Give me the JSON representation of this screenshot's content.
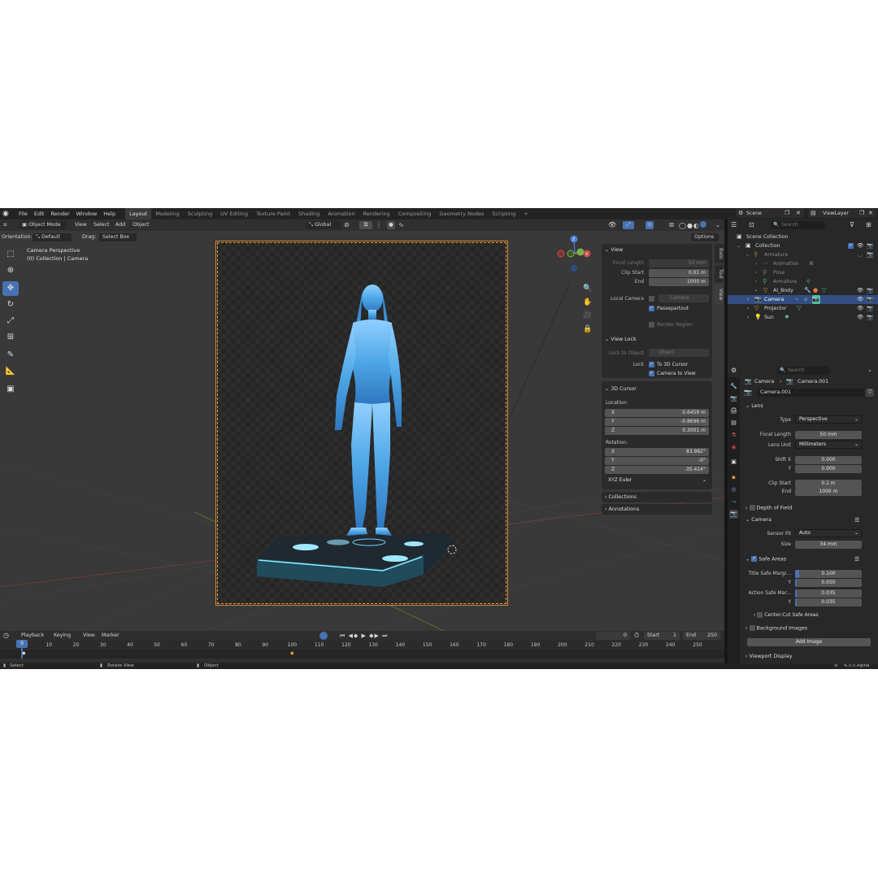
{
  "menu": [
    "File",
    "Edit",
    "Render",
    "Window",
    "Help"
  ],
  "workspaces": [
    "Layout",
    "Modeling",
    "Sculpting",
    "UV Editing",
    "Texture Paint",
    "Shading",
    "Animation",
    "Rendering",
    "Compositing",
    "Geometry Nodes",
    "Scripting"
  ],
  "active_workspace": "Layout",
  "add_tab": "+",
  "scene": "Scene",
  "view_layer": "ViewLayer",
  "viewport": {
    "mode": "Object Mode",
    "menus": [
      "View",
      "Select",
      "Add",
      "Object"
    ],
    "orientation_label": "Orientation:",
    "orientation": "Default",
    "drag_label": "Drag:",
    "drag": "Select Box",
    "transform": "Global",
    "options": "Options",
    "info_line1": "Camera Perspective",
    "info_line2": "(0) Collection | Camera"
  },
  "npanel": {
    "tabs": [
      "Item",
      "Tool",
      "View"
    ],
    "view": {
      "title": "View",
      "focal_length_label": "Focal Length",
      "focal_length": "50 mm",
      "clip_start_label": "Clip Start",
      "clip_start": "0.01 m",
      "end_label": "End",
      "end": "1000 m",
      "local_camera_label": "Local Camera",
      "local_camera": "Camera",
      "passepartout": "Passepartout",
      "render_region": "Render Region"
    },
    "view_lock": {
      "title": "View Lock",
      "lock_to_object_label": "Lock to Object",
      "lock_to_object": "Object",
      "lock_label": "Lock",
      "to_cursor": "To 3D Cursor",
      "camera_to_view": "Camera to View"
    },
    "cursor": {
      "title": "3D Cursor",
      "location_label": "Location:",
      "loc_x": "0.6459 m",
      "loc_y": "-0.8696 m",
      "loc_z": "0.3001 m",
      "rotation_label": "Rotation:",
      "rot_x": "83.982°",
      "rot_y": "-0°",
      "rot_z": "-35.414°",
      "mode": "XYZ Euler",
      "x": "X",
      "y": "Y",
      "z": "Z"
    },
    "collections": "Collections",
    "annotations": "Annotations"
  },
  "timeline": {
    "menus": [
      "Playback",
      "Keying",
      "View",
      "Marker"
    ],
    "current_frame": "0",
    "start_label": "Start",
    "start": "1",
    "end_label": "End",
    "end": "250",
    "ticks": [
      "0",
      "10",
      "20",
      "30",
      "40",
      "50",
      "60",
      "70",
      "80",
      "90",
      "100",
      "110",
      "120",
      "130",
      "140",
      "150",
      "160",
      "170",
      "180",
      "190",
      "200",
      "210",
      "220",
      "230",
      "240",
      "250"
    ]
  },
  "status": {
    "select": "Select",
    "rotate": "Rotate View",
    "object": "Object",
    "version": "4.3.0 Alpha"
  },
  "outliner": {
    "search": "Search",
    "rows": [
      {
        "name": "Scene Collection",
        "indent": 0
      },
      {
        "name": "Collection",
        "indent": 1
      },
      {
        "name": "Armature",
        "indent": 2
      },
      {
        "name": "Animation",
        "indent": 3
      },
      {
        "name": "Pose",
        "indent": 3
      },
      {
        "name": "Armature",
        "indent": 3
      },
      {
        "name": "AI_Body",
        "indent": 3
      },
      {
        "name": "Camera",
        "indent": 2
      },
      {
        "name": "Projector",
        "indent": 2
      },
      {
        "name": "Sun",
        "indent": 2
      }
    ]
  },
  "properties": {
    "search": "Search",
    "breadcrumb_obj": "Camera",
    "breadcrumb_data": "Camera.001",
    "datablock": "Camera.001",
    "lens": {
      "title": "Lens",
      "type_label": "Type",
      "type": "Perspective",
      "focal_label": "Focal Length",
      "focal": "50 mm",
      "unit_label": "Lens Unit",
      "unit": "Millimeters",
      "shiftx_label": "Shift X",
      "shiftx": "0.000",
      "y_label": "Y",
      "shifty": "0.000",
      "clip_start_label": "Clip Start",
      "clip_start": "0.1 m",
      "end_label": "End",
      "end": "1000 m"
    },
    "dof": "Depth of Field",
    "camera": {
      "title": "Camera",
      "fit_label": "Sensor Fit",
      "fit": "Auto",
      "size_label": "Size",
      "size": "34 mm"
    },
    "safe": {
      "title": "Safe Areas",
      "title_margin_label": "Title Safe Margi...",
      "title_x": "0.100",
      "title_y": "0.050",
      "action_label": "Action Safe Mar...",
      "action_x": "0.035",
      "action_y": "0.035",
      "y_label": "Y",
      "center_cut": "Center-Cut Safe Areas"
    },
    "bg": {
      "title": "Background Images",
      "add": "Add Image"
    },
    "viewport_display": "Viewport Display"
  }
}
